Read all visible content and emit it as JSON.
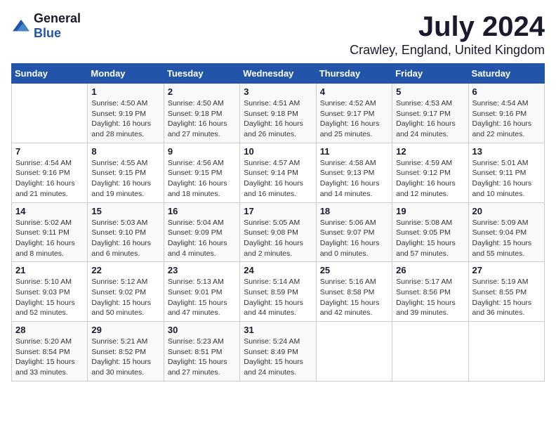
{
  "header": {
    "logo_general": "General",
    "logo_blue": "Blue",
    "month_year": "July 2024",
    "location": "Crawley, England, United Kingdom"
  },
  "days_of_week": [
    "Sunday",
    "Monday",
    "Tuesday",
    "Wednesday",
    "Thursday",
    "Friday",
    "Saturday"
  ],
  "weeks": [
    [
      {
        "day": "",
        "info": ""
      },
      {
        "day": "1",
        "info": "Sunrise: 4:50 AM\nSunset: 9:19 PM\nDaylight: 16 hours\nand 28 minutes."
      },
      {
        "day": "2",
        "info": "Sunrise: 4:50 AM\nSunset: 9:18 PM\nDaylight: 16 hours\nand 27 minutes."
      },
      {
        "day": "3",
        "info": "Sunrise: 4:51 AM\nSunset: 9:18 PM\nDaylight: 16 hours\nand 26 minutes."
      },
      {
        "day": "4",
        "info": "Sunrise: 4:52 AM\nSunset: 9:17 PM\nDaylight: 16 hours\nand 25 minutes."
      },
      {
        "day": "5",
        "info": "Sunrise: 4:53 AM\nSunset: 9:17 PM\nDaylight: 16 hours\nand 24 minutes."
      },
      {
        "day": "6",
        "info": "Sunrise: 4:54 AM\nSunset: 9:16 PM\nDaylight: 16 hours\nand 22 minutes."
      }
    ],
    [
      {
        "day": "7",
        "info": "Sunrise: 4:54 AM\nSunset: 9:16 PM\nDaylight: 16 hours\nand 21 minutes."
      },
      {
        "day": "8",
        "info": "Sunrise: 4:55 AM\nSunset: 9:15 PM\nDaylight: 16 hours\nand 19 minutes."
      },
      {
        "day": "9",
        "info": "Sunrise: 4:56 AM\nSunset: 9:15 PM\nDaylight: 16 hours\nand 18 minutes."
      },
      {
        "day": "10",
        "info": "Sunrise: 4:57 AM\nSunset: 9:14 PM\nDaylight: 16 hours\nand 16 minutes."
      },
      {
        "day": "11",
        "info": "Sunrise: 4:58 AM\nSunset: 9:13 PM\nDaylight: 16 hours\nand 14 minutes."
      },
      {
        "day": "12",
        "info": "Sunrise: 4:59 AM\nSunset: 9:12 PM\nDaylight: 16 hours\nand 12 minutes."
      },
      {
        "day": "13",
        "info": "Sunrise: 5:01 AM\nSunset: 9:11 PM\nDaylight: 16 hours\nand 10 minutes."
      }
    ],
    [
      {
        "day": "14",
        "info": "Sunrise: 5:02 AM\nSunset: 9:11 PM\nDaylight: 16 hours\nand 8 minutes."
      },
      {
        "day": "15",
        "info": "Sunrise: 5:03 AM\nSunset: 9:10 PM\nDaylight: 16 hours\nand 6 minutes."
      },
      {
        "day": "16",
        "info": "Sunrise: 5:04 AM\nSunset: 9:09 PM\nDaylight: 16 hours\nand 4 minutes."
      },
      {
        "day": "17",
        "info": "Sunrise: 5:05 AM\nSunset: 9:08 PM\nDaylight: 16 hours\nand 2 minutes."
      },
      {
        "day": "18",
        "info": "Sunrise: 5:06 AM\nSunset: 9:07 PM\nDaylight: 16 hours\nand 0 minutes."
      },
      {
        "day": "19",
        "info": "Sunrise: 5:08 AM\nSunset: 9:05 PM\nDaylight: 15 hours\nand 57 minutes."
      },
      {
        "day": "20",
        "info": "Sunrise: 5:09 AM\nSunset: 9:04 PM\nDaylight: 15 hours\nand 55 minutes."
      }
    ],
    [
      {
        "day": "21",
        "info": "Sunrise: 5:10 AM\nSunset: 9:03 PM\nDaylight: 15 hours\nand 52 minutes."
      },
      {
        "day": "22",
        "info": "Sunrise: 5:12 AM\nSunset: 9:02 PM\nDaylight: 15 hours\nand 50 minutes."
      },
      {
        "day": "23",
        "info": "Sunrise: 5:13 AM\nSunset: 9:01 PM\nDaylight: 15 hours\nand 47 minutes."
      },
      {
        "day": "24",
        "info": "Sunrise: 5:14 AM\nSunset: 8:59 PM\nDaylight: 15 hours\nand 44 minutes."
      },
      {
        "day": "25",
        "info": "Sunrise: 5:16 AM\nSunset: 8:58 PM\nDaylight: 15 hours\nand 42 minutes."
      },
      {
        "day": "26",
        "info": "Sunrise: 5:17 AM\nSunset: 8:56 PM\nDaylight: 15 hours\nand 39 minutes."
      },
      {
        "day": "27",
        "info": "Sunrise: 5:19 AM\nSunset: 8:55 PM\nDaylight: 15 hours\nand 36 minutes."
      }
    ],
    [
      {
        "day": "28",
        "info": "Sunrise: 5:20 AM\nSunset: 8:54 PM\nDaylight: 15 hours\nand 33 minutes."
      },
      {
        "day": "29",
        "info": "Sunrise: 5:21 AM\nSunset: 8:52 PM\nDaylight: 15 hours\nand 30 minutes."
      },
      {
        "day": "30",
        "info": "Sunrise: 5:23 AM\nSunset: 8:51 PM\nDaylight: 15 hours\nand 27 minutes."
      },
      {
        "day": "31",
        "info": "Sunrise: 5:24 AM\nSunset: 8:49 PM\nDaylight: 15 hours\nand 24 minutes."
      },
      {
        "day": "",
        "info": ""
      },
      {
        "day": "",
        "info": ""
      },
      {
        "day": "",
        "info": ""
      }
    ]
  ]
}
